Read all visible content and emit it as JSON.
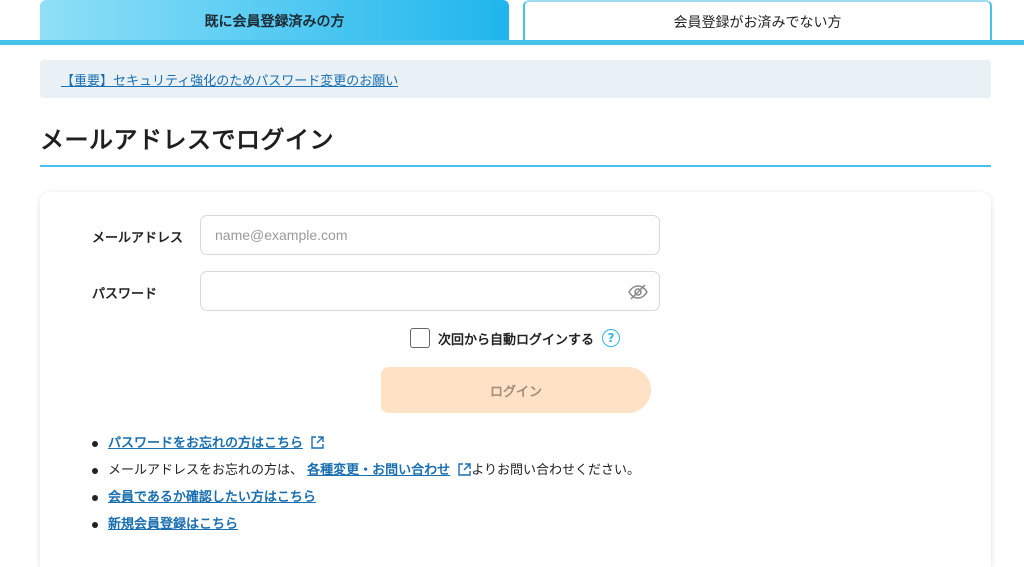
{
  "tabs": {
    "active_label": "既に会員登録済みの方",
    "inactive_label": "会員登録がお済みでない方"
  },
  "notice": {
    "link_text": "【重要】セキュリティ強化のためパスワード変更のお願い"
  },
  "page": {
    "title": "メールアドレスでログイン"
  },
  "form": {
    "email_label": "メールアドレス",
    "email_placeholder": "name@example.com",
    "email_value": "",
    "password_label": "パスワード",
    "password_value": "",
    "remember_label": "次回から自動ログインする",
    "remember_checked": false,
    "help_icon": "question-circle-icon",
    "login_button_label": "ログイン"
  },
  "links": {
    "forgot_password": "パスワードをお忘れの方はこちら",
    "forgot_email_prefix": "メールアドレスをお忘れの方は、",
    "forgot_email_link": "各種変更・お問い合わせ",
    "forgot_email_suffix": "よりお問い合わせください。",
    "check_member": "会員であるか確認したい方はこちら",
    "new_register": "新規会員登録はこちら"
  },
  "colors": {
    "accent": "#45c3ec",
    "link": "#1a6fb0",
    "button_disabled_bg": "#ffe1c6",
    "notice_bg": "#e9f1f6"
  }
}
